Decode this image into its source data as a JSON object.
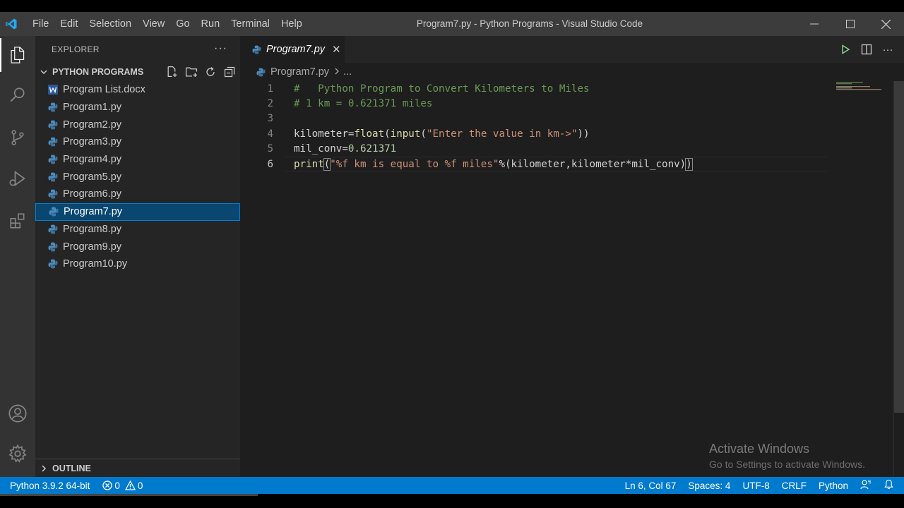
{
  "menu": [
    "File",
    "Edit",
    "Selection",
    "View",
    "Go",
    "Run",
    "Terminal",
    "Help"
  ],
  "window_title": "Program7.py - Python Programs - Visual Studio Code",
  "activity_icons": [
    "files-icon",
    "search-icon",
    "source-control-icon",
    "run-debug-icon",
    "extensions-icon",
    "account-icon",
    "manage-gear-icon"
  ],
  "sidebar": {
    "header": "EXPLORER",
    "more": "···",
    "folder": "PYTHON PROGRAMS",
    "files": [
      {
        "name": "Program List.docx",
        "icon": "word-doc-icon"
      },
      {
        "name": "Program1.py",
        "icon": "python-icon"
      },
      {
        "name": "Program2.py",
        "icon": "python-icon"
      },
      {
        "name": "Program3.py",
        "icon": "python-icon"
      },
      {
        "name": "Program4.py",
        "icon": "python-icon"
      },
      {
        "name": "Program5.py",
        "icon": "python-icon"
      },
      {
        "name": "Program6.py",
        "icon": "python-icon"
      },
      {
        "name": "Program7.py",
        "icon": "python-icon",
        "selected": true
      },
      {
        "name": "Program8.py",
        "icon": "python-icon"
      },
      {
        "name": "Program9.py",
        "icon": "python-icon"
      },
      {
        "name": "Program10.py",
        "icon": "python-icon"
      }
    ],
    "outline": "OUTLINE"
  },
  "editor": {
    "tab": {
      "label": "Program7.py",
      "close": "✕"
    },
    "breadcrumb": {
      "file": "Program7.py",
      "rest": "..."
    },
    "line_numbers": [
      "1",
      "2",
      "3",
      "4",
      "5",
      "6"
    ],
    "code": {
      "l1": "#   Python Program to Convert Kilometers to Miles",
      "l2": "# 1 km = 0.621371 miles",
      "l3": "",
      "l4a": "kilometer=",
      "l4b": "float",
      "l4c": "(",
      "l4d": "input",
      "l4e": "(",
      "l4f": "\"Enter the value in km->\"",
      "l4g": "))",
      "l5a": "mil_conv=",
      "l5b": "0.621371",
      "l6a": "print",
      "l6b": "(",
      "l6c": "\"%f km is equal to %f miles\"",
      "l6d": "%(kilometer,kilometer*mil_conv)",
      "l6e": ")"
    }
  },
  "watermark": {
    "title": "Activate Windows",
    "subtitle": "Go to Settings to activate Windows."
  },
  "status": {
    "python": "Python 3.9.2 64-bit",
    "errors": "0",
    "warnings": "0",
    "position": "Ln 6, Col 67",
    "spaces": "Spaces: 4",
    "encoding": "UTF-8",
    "eol": "CRLF",
    "language": "Python"
  },
  "colors": {
    "accent": "#007acc",
    "selection": "#094771",
    "comment": "#6a9955",
    "string": "#ce9178",
    "function": "#dcdcaa"
  }
}
